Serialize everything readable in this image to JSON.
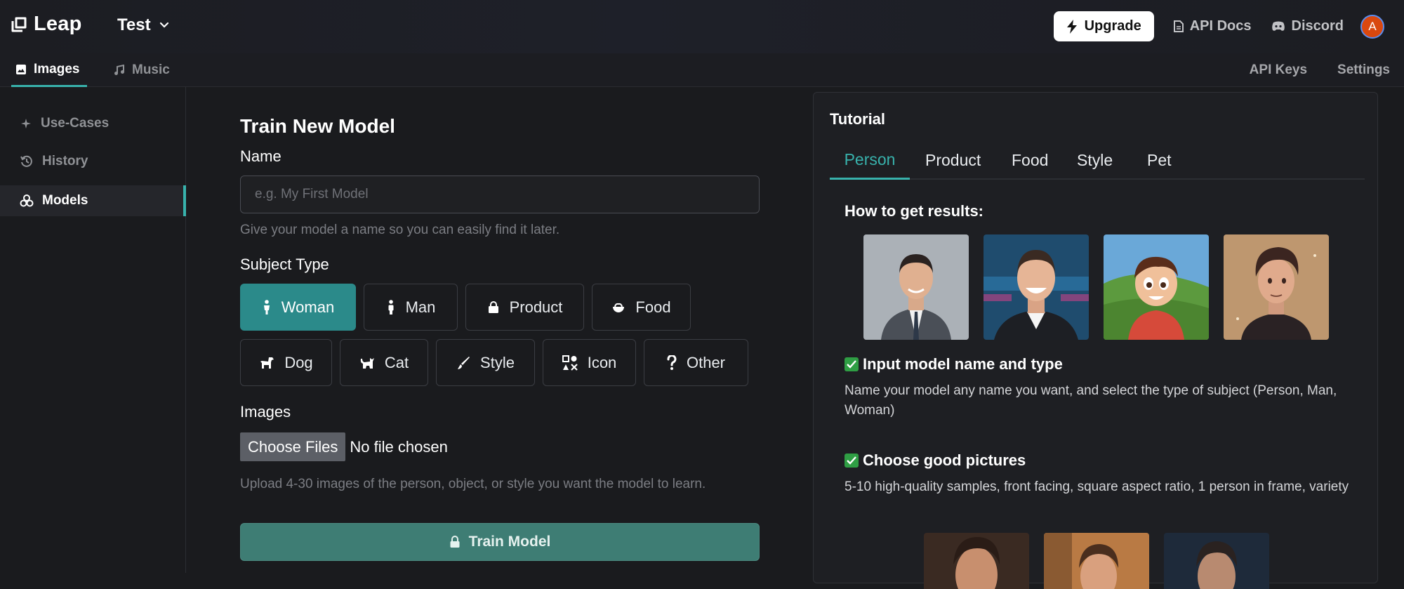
{
  "header": {
    "logo_text": "Leap",
    "project_name": "Test",
    "upgrade_label": "Upgrade",
    "api_docs_label": "API Docs",
    "discord_label": "Discord",
    "avatar_initial": "A"
  },
  "subnav": {
    "tabs": [
      {
        "label": "Images",
        "icon": "image-icon",
        "active": true
      },
      {
        "label": "Music",
        "icon": "music-note-icon",
        "active": false
      }
    ],
    "right_links": [
      "API Keys",
      "Settings"
    ]
  },
  "sidebar": {
    "items": [
      {
        "label": "Use-Cases",
        "icon": "sparkle-icon",
        "active": false
      },
      {
        "label": "History",
        "icon": "history-icon",
        "active": false
      },
      {
        "label": "Models",
        "icon": "models-icon",
        "active": true
      }
    ]
  },
  "form": {
    "title": "Train New Model",
    "name_label": "Name",
    "name_value": "",
    "name_placeholder": "e.g. My First Model",
    "name_hint": "Give your model a name so you can easily find it later.",
    "subject_label": "Subject Type",
    "subject_types": [
      {
        "label": "Woman",
        "icon": "woman-icon",
        "active": true
      },
      {
        "label": "Man",
        "icon": "man-icon",
        "active": false
      },
      {
        "label": "Product",
        "icon": "bag-icon",
        "active": false
      },
      {
        "label": "Food",
        "icon": "bowl-icon",
        "active": false
      },
      {
        "label": "Dog",
        "icon": "dog-icon",
        "active": false
      },
      {
        "label": "Cat",
        "icon": "cat-icon",
        "active": false
      },
      {
        "label": "Style",
        "icon": "brush-icon",
        "active": false
      },
      {
        "label": "Icon",
        "icon": "shapes-icon",
        "active": false
      },
      {
        "label": "Other",
        "icon": "question-icon",
        "active": false
      }
    ],
    "images_label": "Images",
    "choose_files_label": "Choose Files",
    "file_status": "No file chosen",
    "images_hint": "Upload 4-30 images of the person, object, or style you want the model to learn.",
    "train_label": "Train Model"
  },
  "tutorial": {
    "title": "Tutorial",
    "tabs": [
      "Person",
      "Product",
      "Food",
      "Style",
      "Pet"
    ],
    "active_tab": "Person",
    "how_heading": "How to get results:",
    "steps": [
      {
        "heading": "Input model name and type",
        "body": "Name your model any name you want, and select the type of subject (Person, Man, Woman)"
      },
      {
        "heading": "Choose good pictures",
        "body": "5-10 high-quality samples, front facing, square aspect ratio, 1 person in frame, variety"
      }
    ]
  },
  "colors": {
    "accent": "#38b2ac",
    "chip_active": "#2b8a8a",
    "train_button": "#3e7d74",
    "background": "#1a1b1e"
  }
}
